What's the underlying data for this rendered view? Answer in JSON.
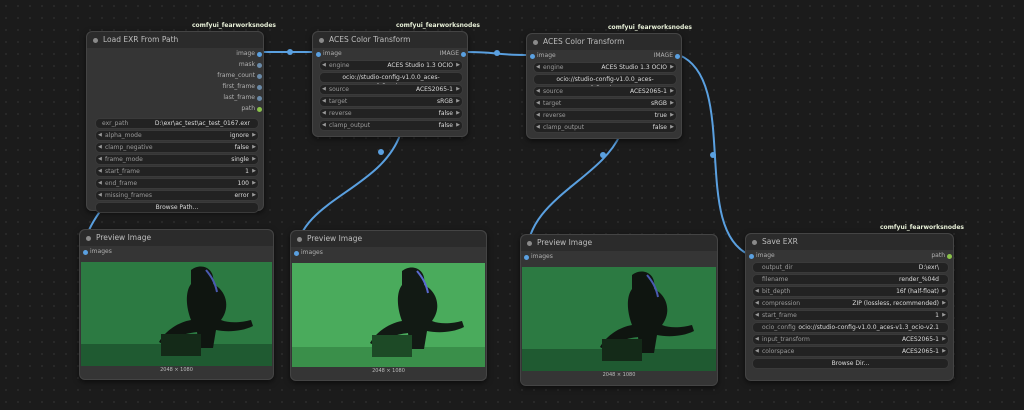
{
  "colors": {
    "canvas": "#1b1b1b",
    "node": "#353535",
    "title_bar": "#2b2b2b",
    "link": "#5aa0e0",
    "port_blue": "#5aa0e0",
    "port_green": "#8bc34a",
    "image_bg": "#2a6b3e"
  },
  "badge": "comfyui_fearworksnodes",
  "load_exr": {
    "title": "Load EXR From Path",
    "outputs": [
      "image",
      "mask",
      "frame_count",
      "first_frame",
      "last_frame",
      "path"
    ],
    "widgets": [
      {
        "label": "exr_path",
        "value": "D:\\exr\\ac_test\\ac_test_0167.exr"
      },
      {
        "label": "alpha_mode",
        "value": "ignore"
      },
      {
        "label": "clamp_negative",
        "value": "false"
      },
      {
        "label": "frame_mode",
        "value": "single"
      },
      {
        "label": "start_frame",
        "value": "1"
      },
      {
        "label": "end_frame",
        "value": "100"
      },
      {
        "label": "missing_frames",
        "value": "error"
      }
    ],
    "button": "Browse Path..."
  },
  "aces1": {
    "title": "ACES Color Transform",
    "input": "image",
    "output": "IMAGE",
    "widgets": [
      {
        "label": "engine",
        "value": "ACES Studio 1.3 OCIO"
      },
      {
        "label": "",
        "value": "ocio://studio-config-v1.0.0_aces-v1.3_ocio-..."
      },
      {
        "label": "source",
        "value": "ACES2065-1"
      },
      {
        "label": "target",
        "value": "sRGB"
      },
      {
        "label": "reverse",
        "value": "false"
      },
      {
        "label": "clamp_output",
        "value": "false"
      }
    ]
  },
  "aces2": {
    "title": "ACES Color Transform",
    "input": "image",
    "output": "IMAGE",
    "widgets": [
      {
        "label": "engine",
        "value": "ACES Studio 1.3 OCIO"
      },
      {
        "label": "",
        "value": "ocio://studio-config-v1.0.0_aces-v1.3_ocio-..."
      },
      {
        "label": "source",
        "value": "ACES2065-1"
      },
      {
        "label": "target",
        "value": "sRGB"
      },
      {
        "label": "reverse",
        "value": "true"
      },
      {
        "label": "clamp_output",
        "value": "false"
      }
    ]
  },
  "preview1": {
    "title": "Preview Image",
    "input": "images",
    "caption": "2048 × 1080"
  },
  "preview2": {
    "title": "Preview Image",
    "input": "images",
    "caption": "2048 × 1080"
  },
  "preview3": {
    "title": "Preview Image",
    "input": "images",
    "caption": "2048 × 1080"
  },
  "save_exr": {
    "title": "Save EXR",
    "input": "image",
    "output": "path",
    "widgets": [
      {
        "label": "output_dir",
        "value": "D:\\exr\\"
      },
      {
        "label": "filename",
        "value": "render_%04d"
      },
      {
        "label": "bit_depth",
        "value": "16f (half-float)"
      },
      {
        "label": "compression",
        "value": "ZIP (lossless, recommended)"
      },
      {
        "label": "start_frame",
        "value": "1"
      },
      {
        "label": "ocio_config",
        "value": "ocio://studio-config-v1.0.0_aces-v1.3_ocio-v2.1"
      },
      {
        "label": "input_transform",
        "value": "ACES2065-1"
      },
      {
        "label": "colorspace",
        "value": "ACES2065-1"
      }
    ],
    "button": "Browse Dir..."
  }
}
